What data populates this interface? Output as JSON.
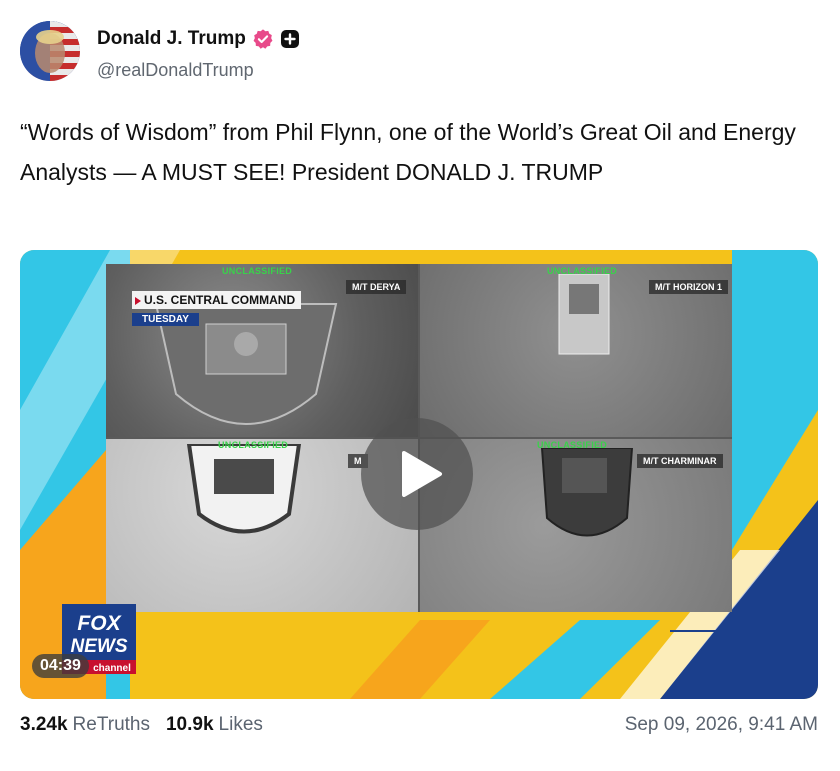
{
  "author": {
    "display_name": "Donald J. Trump",
    "handle": "@realDonaldTrump",
    "verified_icon": "verified-badge-icon",
    "extra_icon": "plus-square-icon"
  },
  "post": {
    "text": "“Words of Wisdom” from Phil Flynn, one of the World’s Great Oil and Energy Analysts — A MUST SEE! President DONALD J. TRUMP"
  },
  "media": {
    "type": "video",
    "duration": "04:39",
    "play_icon": "play-icon",
    "overlay": {
      "lower_third_title": "U.S. CENTRAL COMMAND",
      "lower_third_sub": "TUESDAY",
      "classification": "UNCLASSIFIED",
      "vessels": [
        "M/T DERYA",
        "M/T HORIZON 1",
        "M",
        "M/T CHARMINAR"
      ],
      "network_logo_line1": "FOX",
      "network_logo_line2": "NEWS",
      "network_logo_line3": "channel"
    },
    "colors": {
      "orange": "#f4c21a",
      "cyan": "#33c6e6",
      "navy": "#1b3f8c"
    }
  },
  "stats": {
    "retruths_count": "3.24k",
    "retruths_label": "ReTruths",
    "likes_count": "10.9k",
    "likes_label": "Likes"
  },
  "timestamp": "Sep 09, 2026, 9:41 AM"
}
